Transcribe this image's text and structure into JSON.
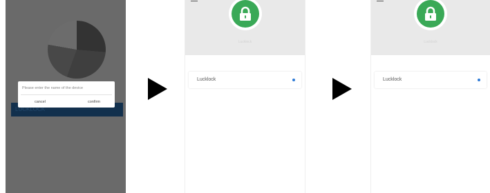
{
  "screen1": {
    "dialog": {
      "prompt": "Please enter the name of the device",
      "cancel": "cancel",
      "confirm": "confirm"
    },
    "bar_label": "LUCKLOCK"
  },
  "screen2": {
    "sublabel": "Lucklock",
    "device_name": "Lucklock"
  },
  "screen3": {
    "sublabel": "Lucklock",
    "device_name": "Lucklock"
  },
  "colors": {
    "lock_green": "#3aa957",
    "status_dot": "#2f7bd6",
    "overlay_gray": "#6a6a6a",
    "navy_bar": "#12304d"
  },
  "icons": [
    "hamburger-menu-icon",
    "padlock-icon",
    "play-arrow-icon"
  ]
}
